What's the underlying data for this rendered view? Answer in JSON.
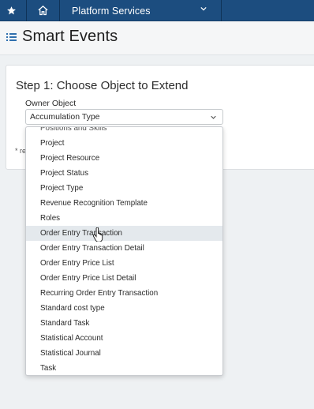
{
  "topbar": {
    "services_label": "Platform Services"
  },
  "header": {
    "title": "Smart Events"
  },
  "form": {
    "step_heading": "Step 1: Choose Object to Extend",
    "owner_label": "Owner Object",
    "owner_value": "Accumulation Type",
    "required_note": "* re"
  },
  "dropdown": {
    "items": [
      "Positions and Skills",
      "Project",
      "Project Resource",
      "Project Status",
      "Project Type",
      "Revenue Recognition Template",
      "Roles",
      "Order Entry Transaction",
      "Order Entry Transaction Detail",
      "Order Entry Price List",
      "Order Entry Price List Detail",
      "Recurring Order Entry Transaction",
      "Standard cost type",
      "Standard Task",
      "Statistical Account",
      "Statistical Journal",
      "Task"
    ],
    "highlighted": "Order Entry Transaction"
  },
  "colors": {
    "nav_bar": "#1c4d7f",
    "title_icon": "#2f6fae",
    "highlight_row": "#e4e9ed"
  }
}
